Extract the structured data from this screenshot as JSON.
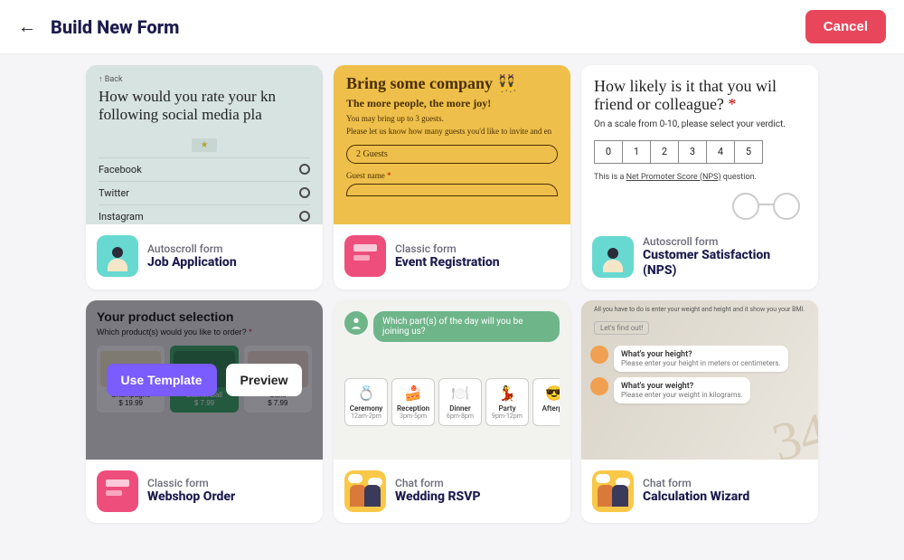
{
  "header": {
    "title": "Build New Form",
    "cancel": "Cancel"
  },
  "hover": {
    "use": "Use Template",
    "preview": "Preview"
  },
  "templates": [
    {
      "tag": "Autoscroll form",
      "name": "Job Application",
      "preview": {
        "back": "↑  Back",
        "question": "How would you rate your kn following social media pla",
        "options": [
          "Facebook",
          "Twitter",
          "Instagram"
        ]
      }
    },
    {
      "tag": "Classic form",
      "name": "Event Registration",
      "preview": {
        "h1": "Bring some company 👯",
        "h2": "The more people, the more joy!",
        "l1": "You may bring up to 3 guests.",
        "l2": "Please let us know how many guests you'd like to invite and en",
        "pill": "2 Guests",
        "label": "Guest name",
        "req": "*"
      }
    },
    {
      "tag": "Autoscroll form",
      "name": "Customer Satisfaction (NPS)",
      "preview": {
        "question": "How likely is it that you wil friend or colleague? ",
        "req": "*",
        "sub": "On a scale from 0-10, please select your verdict.",
        "scale": [
          "0",
          "1",
          "2",
          "3",
          "4",
          "5"
        ],
        "note_pre": "This is a ",
        "note_link": "Net Promoter Score (NPS)",
        "note_post": " question."
      }
    },
    {
      "tag": "Classic form",
      "name": "Webshop Order",
      "preview": {
        "h": "Your product selection",
        "sub": "Which product(s) would you like to order?",
        "req": "*",
        "products": [
          {
            "name": "Champagne",
            "price": "$ 19.99"
          },
          {
            "name": "Basket Ball",
            "price": "$ 7.99"
          },
          {
            "name": "Cake",
            "price": "$ 7.99"
          }
        ]
      }
    },
    {
      "tag": "Chat form",
      "name": "Wedding RSVP",
      "preview": {
        "bubble": "Which part(s) of the day will you be joining us?",
        "options": [
          {
            "emoji": "💍",
            "l1": "Ceremony",
            "l2": "12am-2pm"
          },
          {
            "emoji": "🍰",
            "l1": "Reception",
            "l2": "3pm-5pm"
          },
          {
            "emoji": "🍽️",
            "l1": "Dinner",
            "l2": "6pm-8pm"
          },
          {
            "emoji": "💃",
            "l1": "Party",
            "l2": "9pm-12pm"
          },
          {
            "emoji": "😎",
            "l1": "Afterpa",
            "l2": ""
          }
        ]
      }
    },
    {
      "tag": "Chat form",
      "name": "Calculation Wizard",
      "preview": {
        "intro": "All you have to do is enter your weight and height and it show you your BMI.",
        "start": "Let's find out!",
        "m1_t": "What's your height?",
        "m1_d": "Please enter your height in meters or centimeters.",
        "m2_t": "What's your weight?",
        "m2_d": "Please enter your weight in kilograms."
      }
    }
  ]
}
